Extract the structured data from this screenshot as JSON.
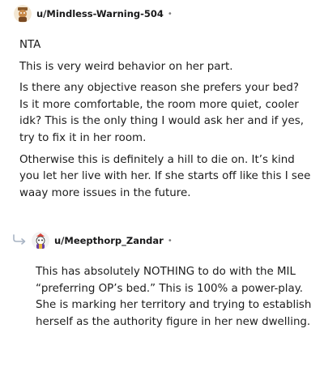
{
  "comments": [
    {
      "username": "u/Mindless-Warning-504",
      "separator": "•",
      "avatar_icon": "snoo-avatar-icon",
      "paragraphs": [
        "NTA",
        "This is very weird behavior on her part.",
        "Is there any objective reason she prefers your bed? Is it more comfortable, the room more quiet, cooler idk? This is the only thing I would ask her and if yes, try to fix it in her room.",
        "Otherwise this is definitely a hill to die on. It’s kind you let her live with her. If she starts off like this I see waay more issues in the future."
      ]
    },
    {
      "username": "u/Meepthorp_Zandar",
      "separator": "•",
      "avatar_icon": "snoo-avatar-icon",
      "reply_icon": "reply-arrow-icon",
      "paragraphs": [
        "This has absolutely NOTHING to do with the MIL “preferring OP’s bed.” This is 100% a power-play. She is marking her territory and trying to establish herself as the authority figure in her new dwelling."
      ]
    }
  ],
  "colors": {
    "text": "#1c1c1c",
    "meta": "#7c7c7c",
    "reply_arrow": "#a8b4c4"
  }
}
